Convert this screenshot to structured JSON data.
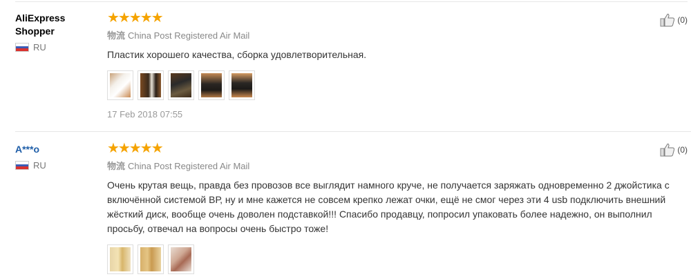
{
  "reviews": [
    {
      "user_name": "AliExpress Shopper",
      "country": "RU",
      "stars": "★★★★★",
      "shipping_label": "物流",
      "shipping_method": "China Post Registered Air Mail",
      "text": "Пластик хорошего качества, сборка удовлетворительная.",
      "photo_count": 5,
      "date": "17 Feb 2018 07:55",
      "likes": "(0)"
    },
    {
      "user_name": "A***o",
      "country": "RU",
      "stars": "★★★★★",
      "shipping_label": "物流",
      "shipping_method": "China Post Registered Air Mail",
      "text": "Очень крутая вещь, правда без провозов все выглядит намного круче, не получается заряжать одновременно 2 джойстика с включённой системой ВР, ну и мне кажется не совсем крепко лежат очки, ещё не смог через эти 4 usb подключить внешний жёсткий диск, вообще очень доволен подставкой!!! Спасибо продавцу, попросил упаковать более надежно, он выполнил просьбу, отвечал на вопросы очень быстро тоже!",
      "photo_count": 3,
      "likes": "(0)"
    }
  ],
  "colors": {
    "star": "#f5a300",
    "link": "#1f5ea8",
    "divider": "#e6e6e6"
  },
  "icons": [
    "thumbs-up-icon",
    "flag-ru-icon",
    "star-icon"
  ]
}
